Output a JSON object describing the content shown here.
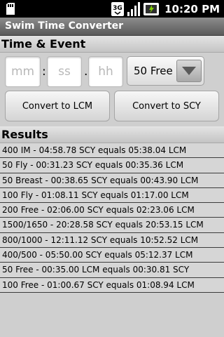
{
  "status_bar": {
    "time": "10:20 PM",
    "network_label": "3G",
    "icons": [
      "sd-card-icon",
      "network-3g-icon",
      "signal-bars-icon",
      "battery-charging-icon"
    ]
  },
  "app": {
    "title": "Swim Time Converter"
  },
  "time_event": {
    "header": "Time & Event",
    "minutes_placeholder": "mm",
    "seconds_placeholder": "ss",
    "hundredths_placeholder": "hh",
    "separator_colon": ":",
    "separator_dot": ".",
    "event_selected": "50 Free"
  },
  "buttons": {
    "convert_lcm": "Convert to LCM",
    "convert_scy": "Convert to SCY"
  },
  "results": {
    "header": "Results",
    "items": [
      "400 IM - 04:58.78 SCY equals 05:38.04 LCM",
      "50 Fly - 00:31.23 SCY equals 00:35.36 LCM",
      "50 Breast - 00:38.65 SCY equals 00:43.90 LCM",
      "100 Fly - 01:08.11 SCY equals 01:17.00 LCM",
      "200 Free - 02:06.00 SCY equals 02:23.06 LCM",
      "1500/1650 - 20:28.58 SCY equals 20:53.15 LCM",
      "800/1000 - 12:11.12 SCY equals 10:52.52 LCM",
      "400/500 - 05:50.00 SCY equals 05:12.37 LCM",
      "50 Free - 00:35.00 LCM equals 00:30.81 SCY",
      "100 Free - 01:00.67 SCY equals 01:08.94 LCM"
    ]
  }
}
